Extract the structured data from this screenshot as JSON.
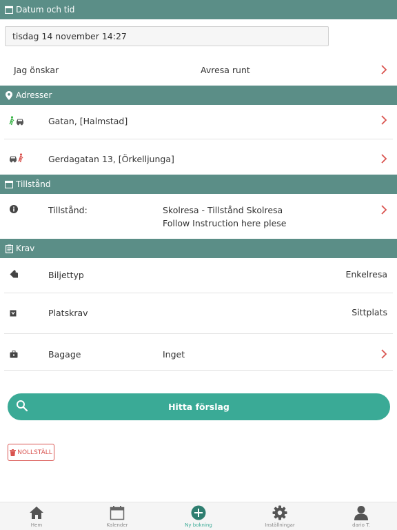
{
  "sections": {
    "datetime": "Datum och tid",
    "addresses": "Adresser",
    "permit": "Tillstånd",
    "requirements": "Krav"
  },
  "datetime": {
    "value": "tisdag 14 november 14:27",
    "wish_label": "Jag önskar",
    "wish_value": "Avresa runt"
  },
  "addresses": [
    {
      "text": "Gatan, [Halmstad]",
      "icon": "walk-car-icon"
    },
    {
      "text": "Gerdagatan 13, [Örkelljunga]",
      "icon": "car-walk-icon"
    }
  ],
  "permit": {
    "label": "Tillstånd:",
    "value_line1": "Skolresa - Tillstånd Skolresa",
    "value_line2": "Follow  Instruction here plese"
  },
  "requirements": [
    {
      "label": "Biljettyp",
      "value": "Enkelresa",
      "icon": "tag-icon"
    },
    {
      "label": "Platskrav",
      "value": "Sittplats",
      "icon": "seat-icon"
    },
    {
      "label": "Bagage",
      "value": "Inget",
      "icon": "luggage-icon"
    }
  ],
  "actions": {
    "find": "Hitta förslag",
    "reset": "NOLLSTÄLL"
  },
  "tabs": [
    {
      "label": "Hem",
      "icon": "home-icon"
    },
    {
      "label": "Kalender",
      "icon": "calendar-icon"
    },
    {
      "label": "Ny bokning",
      "icon": "plus-circle-icon"
    },
    {
      "label": "Inställningar",
      "icon": "gear-icon"
    },
    {
      "label": "dario T.",
      "icon": "user-icon"
    }
  ],
  "colors": {
    "header": "#5b8e87",
    "accent": "#3aaa96",
    "chevron": "#d9534f",
    "reset": "#d9534f"
  }
}
